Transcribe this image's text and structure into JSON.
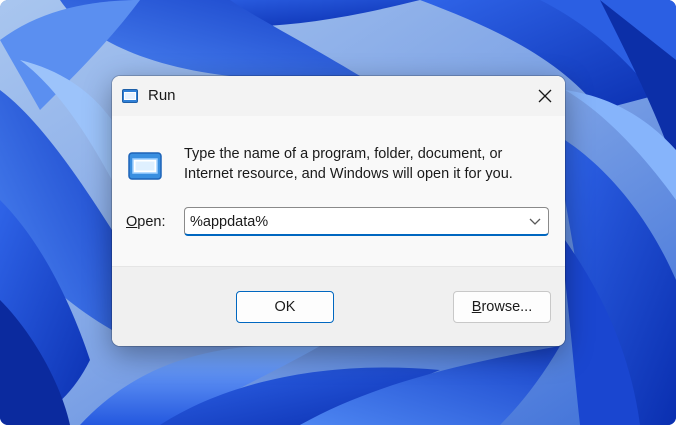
{
  "window": {
    "title": "Run",
    "icon": "run-app-icon",
    "close_icon": "close-icon"
  },
  "dialog": {
    "description": "Type the name of a program, folder, document, or Internet resource, and Windows will open it for you.",
    "open_label_prefix": "O",
    "open_label_rest": "pen:",
    "open_value": "%appdata%",
    "dropdown_icon": "chevron-down-icon"
  },
  "buttons": {
    "ok_label": "OK",
    "browse_label_prefix": "B",
    "browse_label_rest": "rowse..."
  },
  "colors": {
    "accent": "#0067c0",
    "wallpaper_base": "#1a4fd6",
    "wallpaper_light": "#9dc0f5"
  }
}
